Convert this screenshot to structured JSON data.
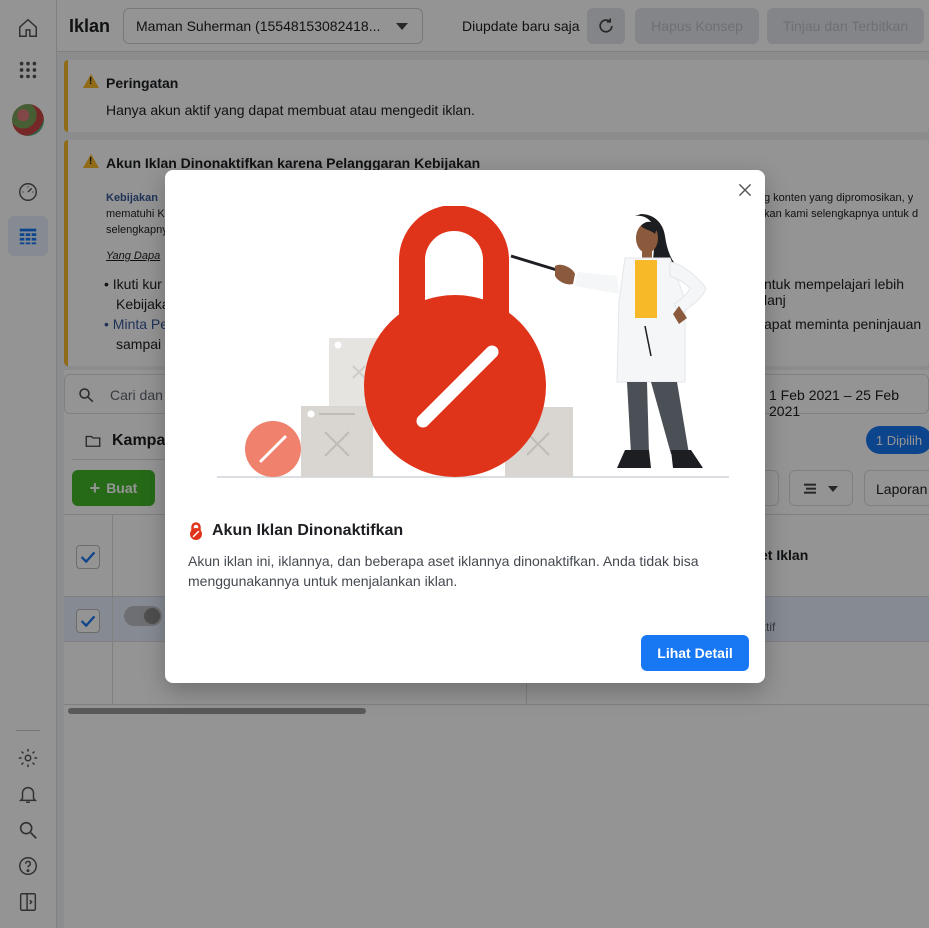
{
  "app": {
    "title": "Iklan"
  },
  "account_selector": {
    "value": "Maman Suherman (15548153082418..."
  },
  "header": {
    "updated_label": "Diupdate baru saja",
    "discard_label": "Hapus Konsep",
    "publish_label": "Tinjau dan Terbitkan"
  },
  "warning_banner": {
    "title": "Peringatan",
    "message": "Hanya akun aktif yang dapat membuat atau mengedit iklan."
  },
  "policy_banner": {
    "title": "Akun Iklan Dinonaktifkan karena Pelanggaran Kebijakan",
    "line1_start": "Kebijakan",
    "line1_end": "g konten yang dipromosikan, y",
    "line2_start": "mematuhi K",
    "line2_end": "kan kami selengkapnya untuk d",
    "line3_start": "selengkapny",
    "what_can": "Yang Dapa",
    "bullet1_start": "Ikuti kur",
    "bullet1_end": "ntuk mempelajari lebih lanj",
    "bullet1_line2": "Kebijaka",
    "bullet2_start": "Minta Pe",
    "bullet2_end": "apat meminta peninjauan",
    "bullet2_line2": "sampai"
  },
  "toolbar": {
    "search_placeholder": "Cari dan",
    "date_range": "1 Feb 2021 – 25 Feb 2021",
    "campaign_tab": "Kampa",
    "selected_badge": "1 Dipilih",
    "create_label": "Buat",
    "reports_label": "Laporan"
  },
  "table": {
    "column_adset": "et Iklan",
    "row_status": "ktif"
  },
  "modal": {
    "title": "Akun Iklan Dinonaktifkan",
    "body": "Akun iklan ini, iklannya, dan beberapa aset iklannya dinonaktifkan. Anda tidak bisa menggunakannya untuk menjalankan iklan.",
    "button": "Lihat Detail"
  },
  "colors": {
    "accent": "#1877f2",
    "lock_red": "#e0341a",
    "warning": "#f7b928"
  },
  "icons": {
    "home": "home-icon",
    "apps": "apps-grid-icon",
    "dashboard": "gauge-icon",
    "ads_manager": "table-icon",
    "settings": "gear-icon",
    "notifications": "bell-icon",
    "search": "search-icon",
    "help": "help-icon",
    "sidebar_toggle": "sidebar-toggle-icon"
  }
}
